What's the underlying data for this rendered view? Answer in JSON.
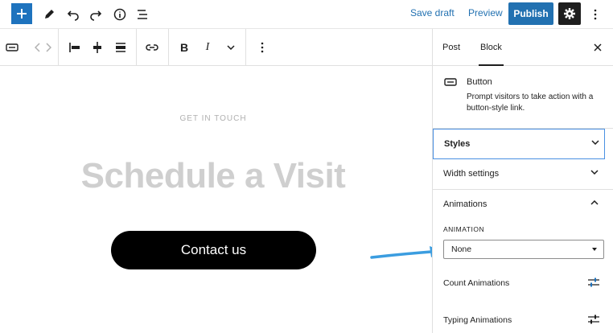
{
  "header": {
    "save_draft": "Save draft",
    "preview": "Preview",
    "publish": "Publish"
  },
  "canvas": {
    "eyebrow": "GET IN TOUCH",
    "headline": "Schedule a Visit",
    "button_label": "Contact us"
  },
  "toolbar": {
    "bold": "B",
    "italic": "I"
  },
  "sidebar": {
    "tabs": [
      {
        "label": "Post"
      },
      {
        "label": "Block"
      }
    ],
    "block_card": {
      "title": "Button",
      "description": "Prompt visitors to take action with a button-style link."
    },
    "panels": {
      "styles": "Styles",
      "width": "Width settings",
      "animations": "Animations"
    },
    "animation": {
      "label": "ANIMATION",
      "selected": "None"
    },
    "count_animations": "Count Animations",
    "typing_animations": "Typing Animations"
  },
  "colors": {
    "accent": "#2271b1",
    "inserter": "#1e73be",
    "focus": "#4a90e2",
    "arrow": "#3b9de0"
  }
}
